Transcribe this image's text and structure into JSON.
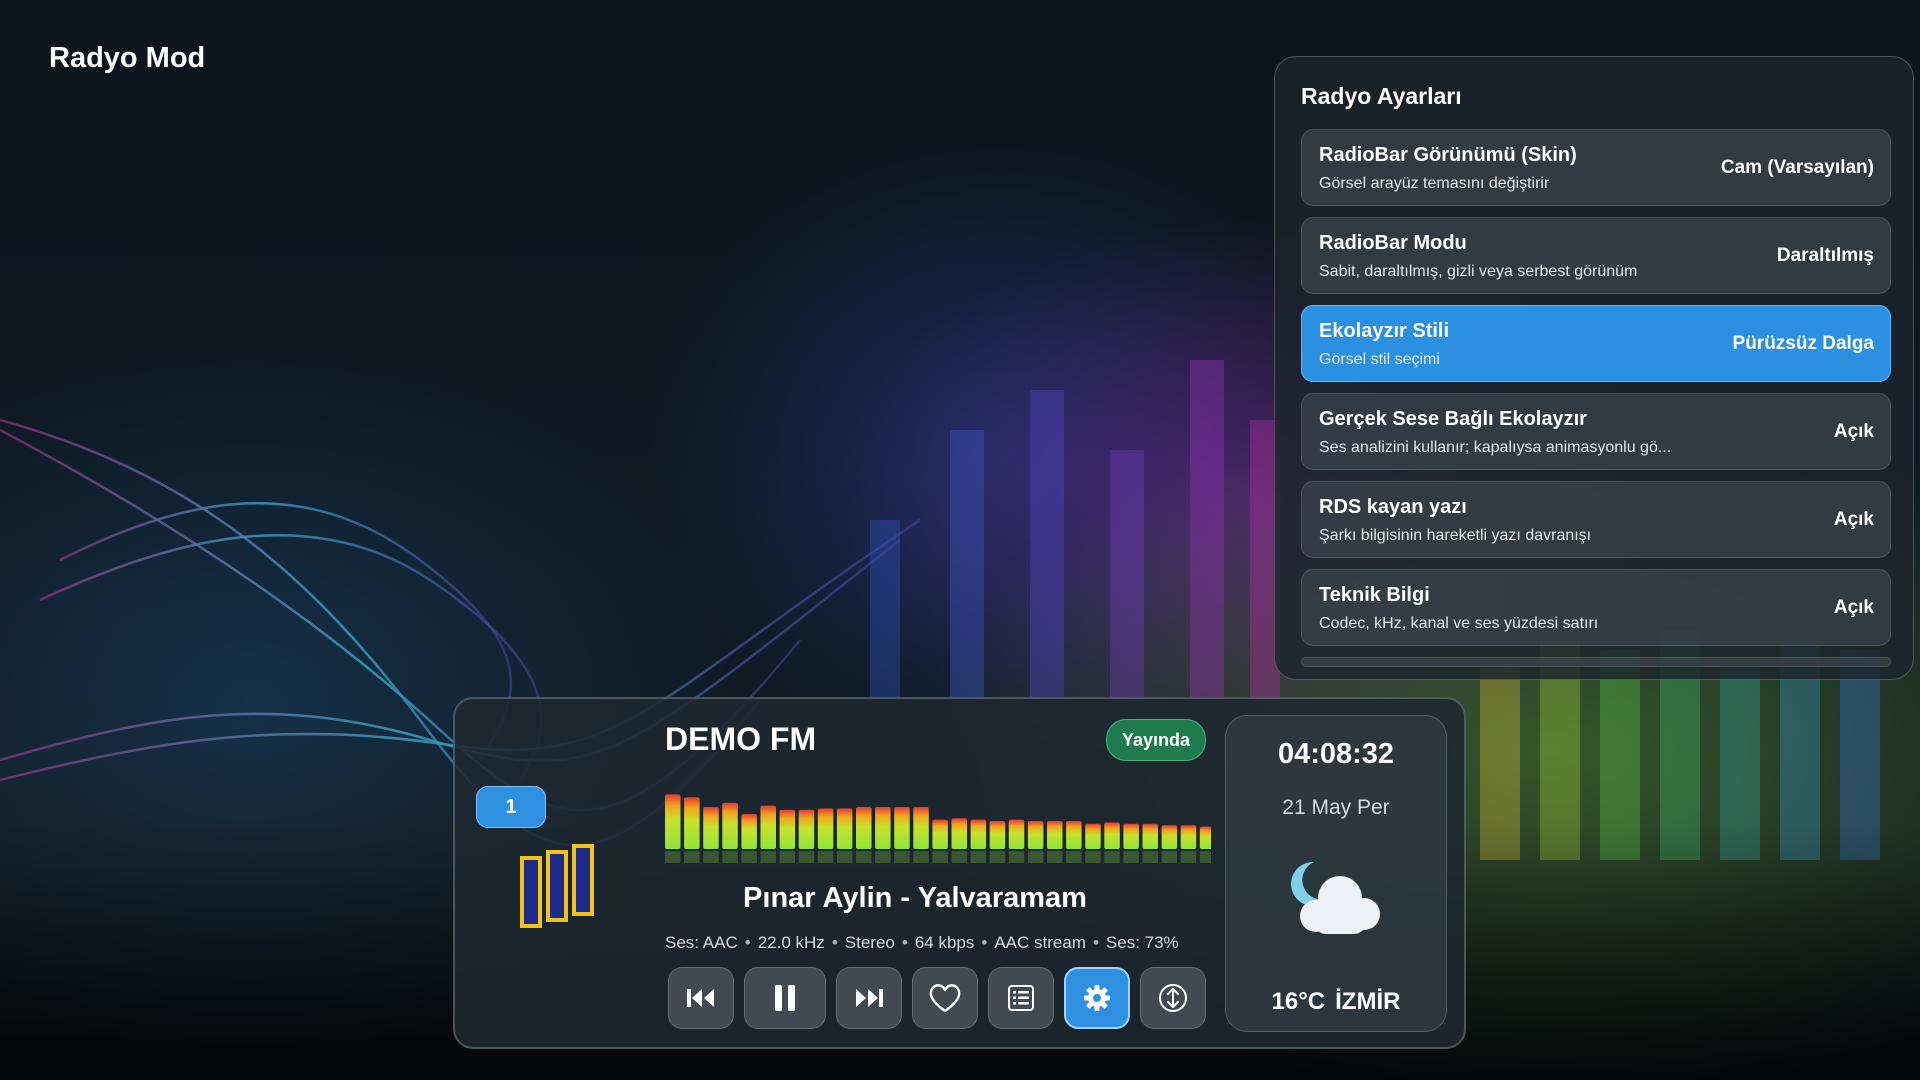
{
  "app": {
    "title": "Radyo Mod"
  },
  "settings": {
    "title": "Radyo Ayarları",
    "items": [
      {
        "name": "RadioBar Görünümü (Skin)",
        "description": "Görsel arayüz temasını değiştirir",
        "value": "Cam (Varsayılan)",
        "selected": false
      },
      {
        "name": "RadioBar Modu",
        "description": "Sabit, daraltılmış, gizli veya serbest görünüm",
        "value": "Daraltılmış",
        "selected": false
      },
      {
        "name": "Ekolayzır Stili",
        "description": "Görsel stil seçimi",
        "value": "Pürüzsüz Dalga",
        "selected": true
      },
      {
        "name": "Gerçek Sese Bağlı Ekolayzır",
        "description": "Ses analizini kullanır; kapalıysa animasyonlu gö...",
        "value": "Açık",
        "selected": false
      },
      {
        "name": "RDS kayan yazı",
        "description": "Şarkı bilgisinin hareketli yazı davranışı",
        "value": "Açık",
        "selected": false
      },
      {
        "name": "Teknik Bilgi",
        "description": "Codec, kHz, kanal ve ses yüzdesi satırı",
        "value": "Açık",
        "selected": false
      }
    ]
  },
  "radio": {
    "channel_number": "1",
    "station_name": "DEMO FM",
    "live_label": "Yayında",
    "song": "Pınar Aylin - Yalvaramam",
    "tech_info": [
      "Ses: AAC",
      "22.0 kHz",
      "Stereo",
      "64 kbps",
      "AAC stream",
      "Ses: 73%"
    ],
    "volume_percent": 73,
    "equalizer_levels": [
      0.78,
      0.74,
      0.6,
      0.66,
      0.5,
      0.62,
      0.56,
      0.56,
      0.58,
      0.58,
      0.6,
      0.6,
      0.6,
      0.6,
      0.42,
      0.44,
      0.42,
      0.4,
      0.42,
      0.4,
      0.4,
      0.4,
      0.36,
      0.38,
      0.36,
      0.36,
      0.34,
      0.34,
      0.32
    ],
    "controls": [
      {
        "name": "previous-button",
        "icon": "skip-previous-icon"
      },
      {
        "name": "pause-button",
        "icon": "pause-icon"
      },
      {
        "name": "next-button",
        "icon": "skip-next-icon"
      },
      {
        "name": "favorite-button",
        "icon": "heart-icon"
      },
      {
        "name": "playlist-button",
        "icon": "list-icon"
      },
      {
        "name": "settings-button",
        "icon": "gear-icon",
        "active": true
      },
      {
        "name": "mode-button",
        "icon": "up-down-arrows-icon"
      }
    ]
  },
  "clock": {
    "time": "04:08:32",
    "date": "21 May Per",
    "temperature": "16°C",
    "city": "İZMİR",
    "weather_icon": "night-cloudy-icon"
  },
  "colors": {
    "accent": "#2f8fe0",
    "live": "#1f7a4e",
    "eq_low": "#8ee63a",
    "eq_high": "#e53935"
  }
}
